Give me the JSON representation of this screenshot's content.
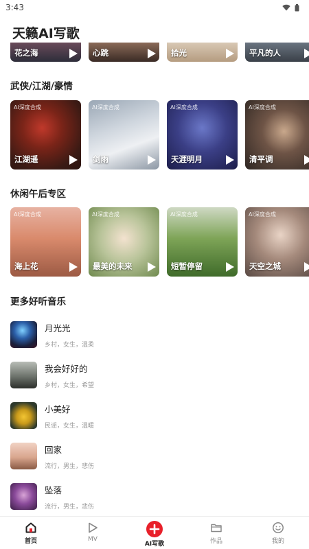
{
  "status": {
    "time": "3:43"
  },
  "app": {
    "title": "天籁AI写歌"
  },
  "top_row": [
    {
      "name": "花之海"
    },
    {
      "name": "心跳"
    },
    {
      "name": "拾光"
    },
    {
      "name": "平凡的人"
    }
  ],
  "sections": [
    {
      "title": "武侠/江湖/豪情",
      "cards": [
        {
          "tag": "AI深度合成",
          "name": "江湖遥"
        },
        {
          "tag": "AI深度合成",
          "name": "剑雨"
        },
        {
          "tag": "AI深度合成",
          "name": "天涯明月"
        },
        {
          "tag": "AI深度合成",
          "name": "清平调"
        }
      ]
    },
    {
      "title": "休闲午后专区",
      "cards": [
        {
          "tag": "AI深度合成",
          "name": "海上花"
        },
        {
          "tag": "AI深度合成",
          "name": "最美的未来"
        },
        {
          "tag": "AI深度合成",
          "name": "短暂停留"
        },
        {
          "tag": "AI深度合成",
          "name": "天空之城"
        }
      ]
    }
  ],
  "more": {
    "title": "更多好听音乐",
    "songs": [
      {
        "title": "月光光",
        "meta": "乡村，女生，温柔"
      },
      {
        "title": "我会好好的",
        "meta": "乡村，女生，希望"
      },
      {
        "title": "小美好",
        "meta": "民谣，女生，温暖"
      },
      {
        "title": "回家",
        "meta": "流行，男生，悲伤"
      },
      {
        "title": "坠落",
        "meta": "流行，男生，悲伤"
      }
    ]
  },
  "nav": {
    "home": "首页",
    "mv": "MV",
    "ai": "AI写歌",
    "works": "作品",
    "mine": "我的"
  },
  "colors": {
    "accent": "#e8202a",
    "text": "#222222",
    "muted": "#9a9a9a"
  }
}
